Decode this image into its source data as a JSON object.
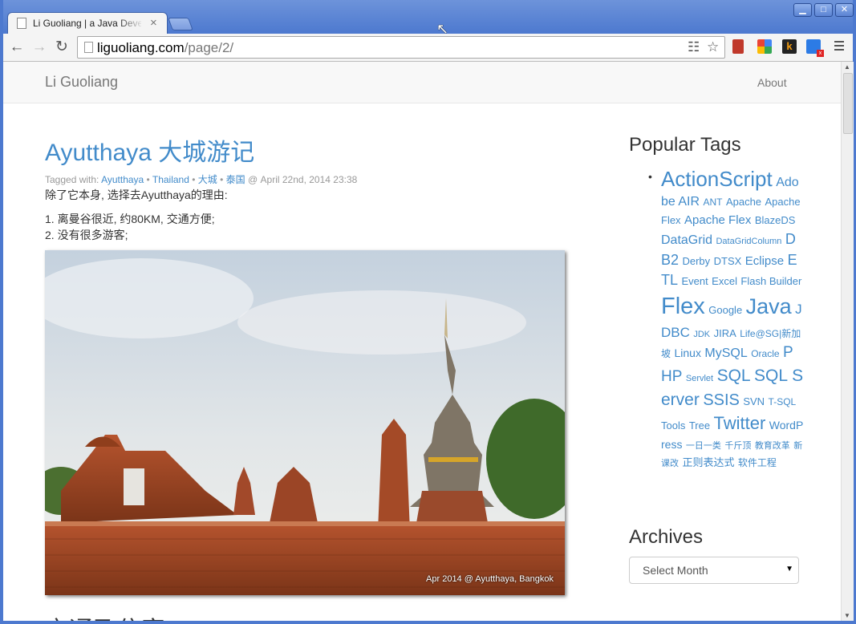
{
  "browser": {
    "tab_title": "Li Guoliang | a Java Developer",
    "url_host": "liguoliang.com",
    "url_path": "/page/2/",
    "buttons": {
      "minimize": "▁",
      "maximize": "□",
      "close": "✕"
    }
  },
  "site": {
    "brand": "Li Guoliang",
    "nav_about": "About"
  },
  "post": {
    "title": "Ayutthaya 大城游记",
    "meta_prefix": "Tagged with: ",
    "tags": [
      "Ayutthaya",
      "Thailand",
      "大城",
      "泰国"
    ],
    "sep": " • ",
    "date": " @ April 22nd, 2014 23:38",
    "intro": "除了它本身, 选择去Ayutthaya的理由:",
    "reasons": [
      "1. 离曼谷很近, 约80KM, 交通方便;",
      "2. 没有很多游客;"
    ],
    "photo_caption": "Apr 2014 @ Ayutthaya, Bangkok",
    "next_heading": "交通及住宿"
  },
  "sidebar": {
    "popular_tags_title": "Popular Tags",
    "tag_cloud": [
      {
        "label": "ActionScript",
        "size": 26
      },
      {
        "label": "Adobe AIR",
        "size": 16
      },
      {
        "label": "ANT",
        "size": 12
      },
      {
        "label": "Apache",
        "size": 13
      },
      {
        "label": "ApacheFlex",
        "size": 13
      },
      {
        "label": "Apache Flex",
        "size": 15
      },
      {
        "label": "BlazeDS",
        "size": 13
      },
      {
        "label": "DataGrid",
        "size": 16
      },
      {
        "label": "DataGridColumn",
        "size": 11
      },
      {
        "label": "DB2",
        "size": 18
      },
      {
        "label": "Derby",
        "size": 13
      },
      {
        "label": "DTSX",
        "size": 13
      },
      {
        "label": "Eclipse",
        "size": 15
      },
      {
        "label": "ETL",
        "size": 18
      },
      {
        "label": "Event",
        "size": 13
      },
      {
        "label": "Excel",
        "size": 13
      },
      {
        "label": "Flash Builder",
        "size": 13
      },
      {
        "label": "Flex",
        "size": 29
      },
      {
        "label": "Google",
        "size": 13
      },
      {
        "label": "Java",
        "size": 27
      },
      {
        "label": "JDBC",
        "size": 17
      },
      {
        "label": "JDK",
        "size": 11
      },
      {
        "label": "JIRA",
        "size": 13
      },
      {
        "label": "Life@SG|新加坡",
        "size": 12
      },
      {
        "label": "Linux",
        "size": 14
      },
      {
        "label": "MySQL",
        "size": 16
      },
      {
        "label": "Oracle",
        "size": 12
      },
      {
        "label": "PHP",
        "size": 19
      },
      {
        "label": "Servlet",
        "size": 11
      },
      {
        "label": "SQL",
        "size": 21
      },
      {
        "label": "SQL Server",
        "size": 21
      },
      {
        "label": "SSIS",
        "size": 20
      },
      {
        "label": "SVN",
        "size": 13
      },
      {
        "label": "T-SQL",
        "size": 12
      },
      {
        "label": "Tools",
        "size": 13
      },
      {
        "label": "Tree",
        "size": 13
      },
      {
        "label": "Twitter",
        "size": 22
      },
      {
        "label": "WordPress",
        "size": 14
      },
      {
        "label": "一日一类",
        "size": 11
      },
      {
        "label": "千斤顶",
        "size": 11
      },
      {
        "label": "教育改革",
        "size": 11
      },
      {
        "label": "新课改",
        "size": 11
      },
      {
        "label": "正则表达式",
        "size": 13
      },
      {
        "label": "软件工程",
        "size": 12
      }
    ],
    "archives_title": "Archives",
    "archives_select": "Select Month"
  },
  "colors": {
    "link": "#428bca",
    "chrome_blue": "#4d79cf"
  },
  "icons": [
    "page-icon",
    "back-arrow-icon",
    "forward-arrow-icon",
    "reload-icon",
    "reader-mode-icon",
    "star-icon",
    "menu-icon"
  ]
}
